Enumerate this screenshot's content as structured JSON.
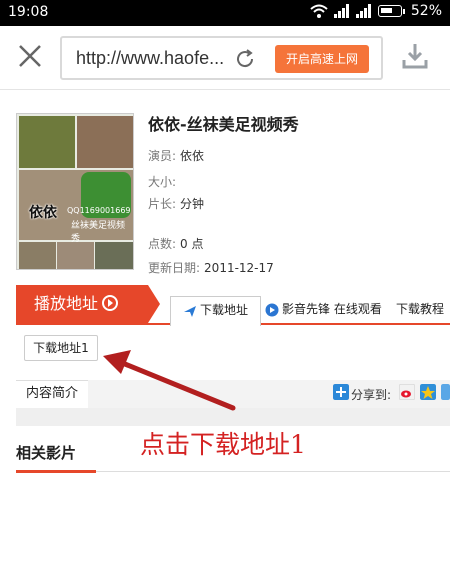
{
  "status_bar": {
    "time": "19:08",
    "battery": "52%"
  },
  "browser": {
    "url": "http://www.haofe...",
    "accelerate_label": "开启高速上网"
  },
  "movie": {
    "title": "依依-丝袜美足视频秀",
    "thumb_caption": "依依",
    "thumb_qq": "QQ1169001669",
    "thumb_sub": "丝袜美足视频秀",
    "info": [
      {
        "label": "演员:",
        "value": "依依"
      },
      {
        "label": "大小:",
        "value": ""
      },
      {
        "label": "片长:",
        "value": "分钟"
      },
      {
        "label": "点数:",
        "value": "0 点"
      },
      {
        "label": "更新日期:",
        "value": "2011-12-17"
      }
    ]
  },
  "play_section": {
    "heading": "播放地址",
    "tabs": [
      "下载地址",
      "影音先锋 在线观看",
      "下载教程"
    ],
    "download_button": "下载地址1"
  },
  "intro": {
    "label": "内容简介",
    "share_label": "分享到:"
  },
  "annotation_text": "点击下载地址1",
  "related_title": "相关影片",
  "colors": {
    "accent": "#e6472a",
    "accelerate": "#f5743a",
    "annotation": "#d42222"
  }
}
